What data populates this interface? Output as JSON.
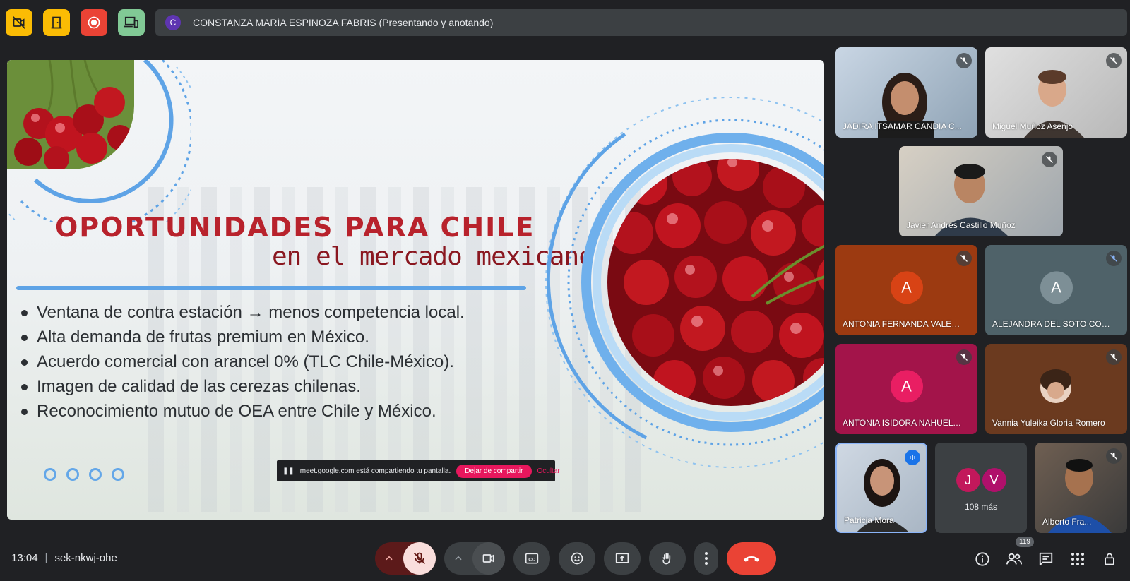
{
  "top_bar": {
    "icons": [
      "no-video-icon",
      "door-icon",
      "record-icon",
      "devices-icon"
    ],
    "presenter_avatar_letter": "C",
    "presenter_text": "CONSTANZA MARÍA ESPINOZA FABRIS (Presentando y anotando)"
  },
  "slide": {
    "title": "OPORTUNIDADES PARA CHILE",
    "subtitle": "en el mercado mexicano",
    "bullets": [
      "Ventana de contra estación → menos competencia local.",
      "Alta demanda de frutas premium en México.",
      "Acuerdo comercial con arancel 0% (TLC Chile-México).",
      "Imagen de calidad de las cerezas chilenas.",
      "Reconocimiento mutuo de OEA entre Chile y México."
    ],
    "share_banner": {
      "text": "meet.google.com está compartiendo tu pantalla.",
      "stop_label": "Dejar de compartir",
      "hide_label": "Ocultar"
    }
  },
  "participants": [
    {
      "name": "JADIRA ITSAMAR CANDIA C..."
    },
    {
      "name": "Miguel Muñoz Asenjo"
    },
    {
      "name": "Javier Andres Castillo Muñoz"
    },
    {
      "name": "ANTONIA FERNANDA VALEN...",
      "letter": "A",
      "color": "#d84315"
    },
    {
      "name": "ALEJANDRA DEL SOTO CON...",
      "letter": "A",
      "color": "#78909c"
    },
    {
      "name": "ANTONIA ISIDORA NAHUEL Y...",
      "letter": "A",
      "color": "#e91e63"
    },
    {
      "name": "Vannia Yuleika Gloria Romero"
    },
    {
      "name": "Patricia Mora"
    },
    {
      "name": "Alberto Fra..."
    }
  ],
  "overflow_tile": {
    "letters": [
      "J",
      "V"
    ],
    "label": "108 más"
  },
  "bottom_bar": {
    "time": "13:04",
    "meeting_code": "sek-nkwj-ohe",
    "participant_count": "119"
  },
  "colors": {
    "background": "#202124",
    "accent_yellow": "#fbbc04",
    "record_red": "#ea4335",
    "devices_green": "#81c995",
    "leave_red": "#ea4335"
  }
}
